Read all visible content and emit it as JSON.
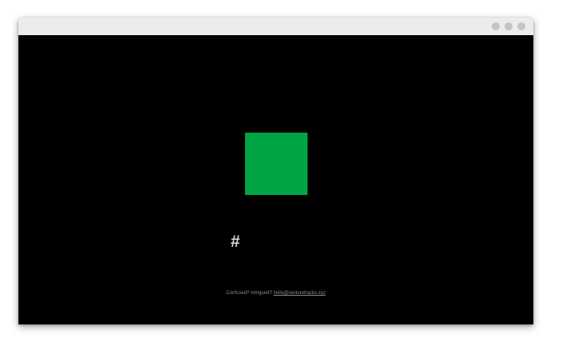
{
  "window": {
    "controls": [
      "dot",
      "dot",
      "dot"
    ]
  },
  "main": {
    "square_color": "#00a643",
    "symbol": "#"
  },
  "footer": {
    "prompt": "Confused? Intrigued?",
    "email": "hello@venturehacks.xyz"
  }
}
